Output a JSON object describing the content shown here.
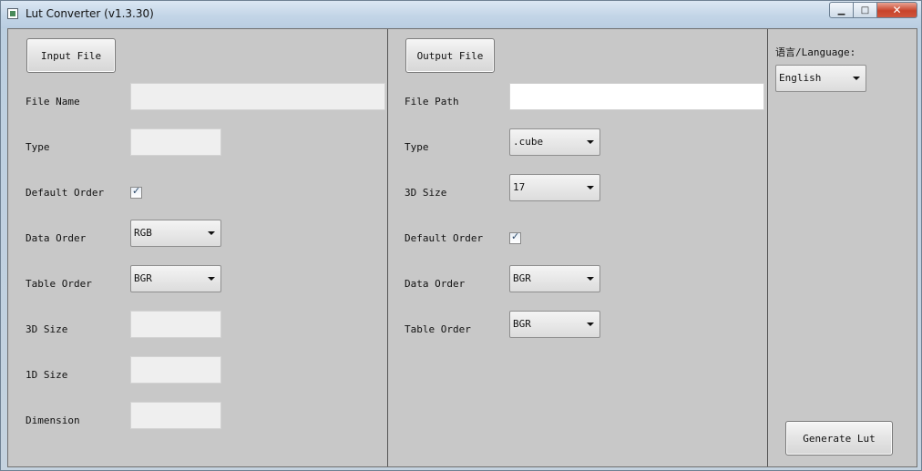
{
  "window": {
    "title": "Lut Converter (v1.3.30)",
    "minimize_glyph": "▁",
    "maximize_glyph": "□",
    "close_glyph": "✕"
  },
  "input": {
    "button_label": "Input File",
    "file_name_label": "File Name",
    "file_name_value": "",
    "type_label": "Type",
    "type_value": "",
    "default_order_label": "Default Order",
    "default_order_checked": true,
    "data_order_label": "Data Order",
    "data_order_value": "RGB",
    "table_order_label": "Table Order",
    "table_order_value": "BGR",
    "size3d_label": "3D Size",
    "size3d_value": "",
    "size1d_label": "1D Size",
    "size1d_value": "",
    "dimension_label": "Dimension",
    "dimension_value": ""
  },
  "output": {
    "button_label": "Output File",
    "file_path_label": "File Path",
    "file_path_value": "",
    "type_label": "Type",
    "type_value": ".cube",
    "size3d_label": "3D Size",
    "size3d_value": "17",
    "default_order_label": "Default Order",
    "default_order_checked": true,
    "data_order_label": "Data Order",
    "data_order_value": "BGR",
    "table_order_label": "Table Order",
    "table_order_value": "BGR"
  },
  "settings": {
    "language_label": "语言/Language:",
    "language_value": "English",
    "generate_label": "Generate Lut"
  },
  "check_glyph": "✓"
}
